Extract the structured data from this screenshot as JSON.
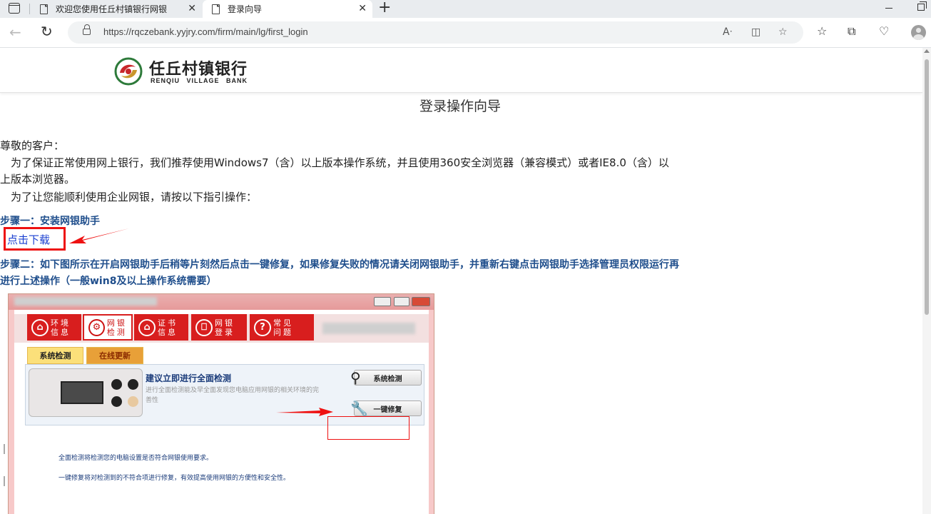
{
  "browser": {
    "tabs": [
      {
        "title": "欢迎您使用任丘村镇银行网银",
        "close": "✕"
      },
      {
        "title": "登录向导",
        "close": "✕"
      }
    ],
    "new_tab": "+",
    "url": "https://rqczebank.yyjry.com/firm/main/lg/first_login",
    "back": "←",
    "reload": "↻"
  },
  "site": {
    "bank_name": "任丘村镇银行",
    "bank_name_en": "RENQIU VILLAGE BANK"
  },
  "guide": {
    "title": "登录操作向导",
    "greeting": "尊敬的客户：",
    "para1_line1": "　为了保证正常使用网上银行，我们推荐使用Windows7（含）以上版本操作系统，并且使用360安全浏览器（兼容模式）或者IE8.0（含）以",
    "para1_line2": "上版本浏览器。",
    "para2": "　为了让您能顺利使用企业网银，请按以下指引操作：",
    "step1": "步骤一：安装网银助手",
    "download_link": "点击下载",
    "step2_line1": "步骤二：如下图所示在开启网银助手后稍等片刻然后点击一键修复，如果修复失败的情况请关闭网银助手，并重新右键点击网银助手选择管理员权限运行再",
    "step2_line2": "进行上述操作（一般win8及以上操作系统需要）"
  },
  "helper": {
    "nav": [
      {
        "icon": "⌂",
        "label": "环境信息"
      },
      {
        "icon": "⚙",
        "label": "网银检测"
      },
      {
        "icon": "⌂",
        "label": "证书信息"
      },
      {
        "icon": "⎕",
        "label": "网银登录"
      },
      {
        "icon": "?",
        "label": "常见问题"
      }
    ],
    "tabs": [
      "系统检测",
      "在线更新"
    ],
    "card_title": "建议立即进行全面检测",
    "card_desc": "进行全面检测能及早全面发现您电脑应用网银的相关环境的完善性",
    "check_button": "系统检测",
    "repair_button": "一键修复",
    "note1": "全面检测将检测您的电脑设置是否符合网银使用要求。",
    "note2": "一键修复将对检测到的不符合项进行修复，有效提高使用网银的方便性和安全性。"
  },
  "colors": {
    "step_blue": "#1f4e8c",
    "link_blue": "#1a3fd0",
    "annotation_red": "#e11111",
    "helper_red": "#d81e1e"
  }
}
